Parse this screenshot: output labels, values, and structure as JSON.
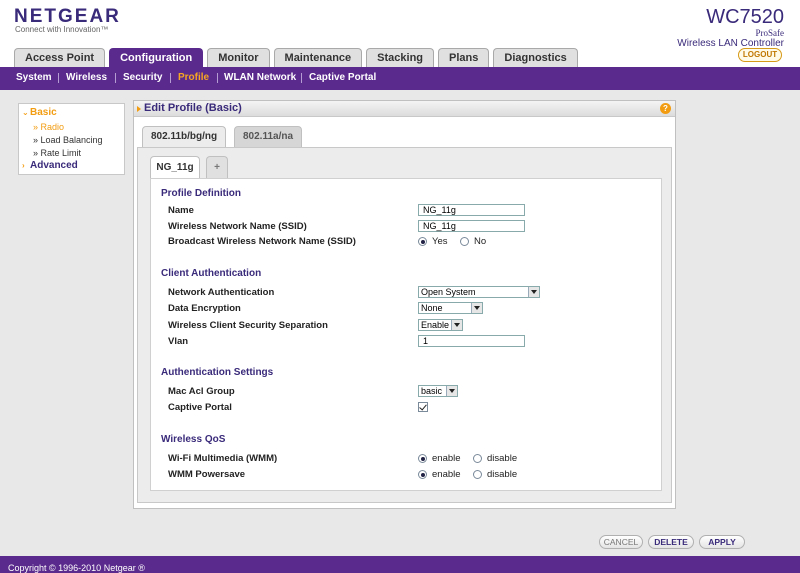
{
  "header": {
    "logo": "NETGEAR",
    "tagline": "Connect with Innovation™",
    "model": "WC7520",
    "product_line1": "ProSafe",
    "product_line2": "Wireless LAN Controller",
    "logout": "LOGOUT"
  },
  "tabs": [
    "Access Point",
    "Configuration",
    "Monitor",
    "Maintenance",
    "Stacking",
    "Plans",
    "Diagnostics"
  ],
  "active_tab": "Configuration",
  "subnav": [
    "System",
    "Wireless",
    "Security",
    "Profile",
    "WLAN Network",
    "Captive Portal"
  ],
  "active_subnav": "Profile",
  "leftnav": {
    "basic": "Basic",
    "radio": "Radio",
    "load_balancing": "Load Balancing",
    "rate_limit": "Rate Limit",
    "advanced": "Advanced"
  },
  "panel": {
    "title": "Edit Profile (Basic)",
    "help": "?",
    "radio_tab_active": "802.11b/bg/ng",
    "radio_tab_inactive": "802.11a/na",
    "profile_tab": "NG_11g",
    "add_tab": "+"
  },
  "sections": {
    "profile_definition": "Profile Definition",
    "client_auth": "Client Authentication",
    "auth_settings": "Authentication Settings",
    "wireless_qos": "Wireless QoS"
  },
  "fields": {
    "name": {
      "label": "Name",
      "value": "NG_11g"
    },
    "ssid": {
      "label": "Wireless Network Name (SSID)",
      "value": "NG_11g"
    },
    "broadcast": {
      "label": "Broadcast Wireless Network Name (SSID)",
      "yes": "Yes",
      "no": "No",
      "selected": "Yes"
    },
    "network_auth": {
      "label": "Network Authentication",
      "value": "Open System"
    },
    "data_encryption": {
      "label": "Data Encryption",
      "value": "None"
    },
    "client_separation": {
      "label": "Wireless Client Security Separation",
      "value": "Enable"
    },
    "vlan": {
      "label": "Vlan",
      "value": "1"
    },
    "mac_acl": {
      "label": "Mac Acl Group",
      "value": "basic"
    },
    "captive_portal": {
      "label": "Captive Portal",
      "checked": true
    },
    "wmm": {
      "label": "Wi-Fi Multimedia (WMM)",
      "enable": "enable",
      "disable": "disable",
      "selected": "enable"
    },
    "wmm_powersave": {
      "label": "WMM Powersave",
      "enable": "enable",
      "disable": "disable",
      "selected": "enable"
    }
  },
  "buttons": {
    "cancel": "CANCEL",
    "delete": "DELETE",
    "apply": "APPLY"
  },
  "footer": "Copyright © 1996-2010 Netgear ®",
  "colors": {
    "brand_purple": "#5a2a8c",
    "accent_orange": "#f29c11"
  }
}
